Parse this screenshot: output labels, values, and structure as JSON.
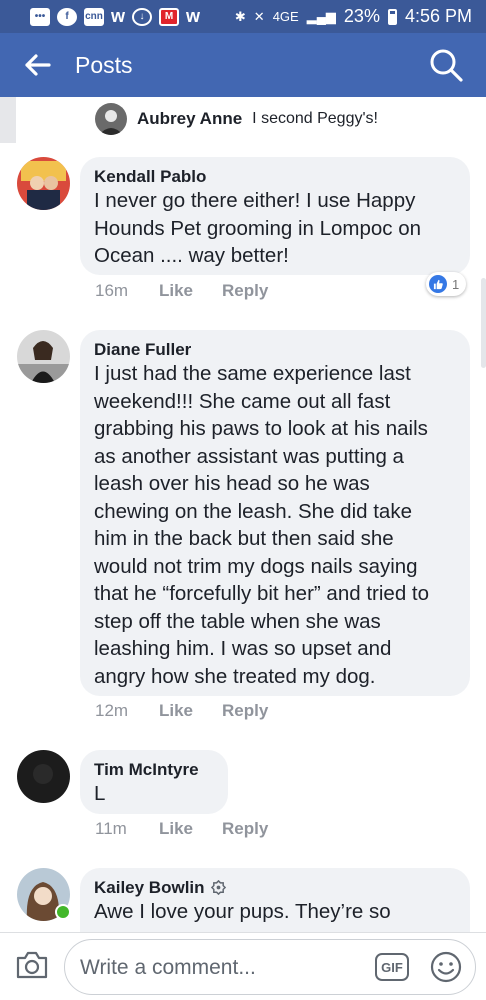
{
  "status_bar": {
    "network": "4GE",
    "battery": "23%",
    "time": "4:56 PM",
    "icons": [
      "messenger-icon",
      "facebook-icon",
      "cnn-icon",
      "w-icon",
      "alert-icon",
      "m-icon",
      "w2-icon",
      "bluetooth-icon",
      "mute-icon",
      "wifi-calling-icon",
      "signal-icon",
      "battery-icon"
    ]
  },
  "header": {
    "title": "Posts"
  },
  "reply_preview": {
    "author": "Aubrey Anne",
    "text": "I second Peggy's!"
  },
  "comments": [
    {
      "author": "Kendall Pablo",
      "lines": [
        "I never go there either! I use Happy",
        "Hounds Pet grooming in Lompoc on",
        "Ocean .... way better!"
      ],
      "time": "16m",
      "like": "Like",
      "reply": "Reply",
      "reactions": "1"
    },
    {
      "author": "Diane Fuller",
      "lines": [
        "I just had the same experience last",
        "weekend!!!  She came out all fast",
        "grabbing his paws to look at his nails",
        "as another assistant was putting a",
        "leash over his head so he was",
        "chewing on the leash. She did take",
        "him in the back but then said she",
        "would not trim my dogs nails saying",
        "that he “forcefully bit her” and tried to",
        "step off the table when she was",
        "leashing him. I was so upset and",
        "angry how she treated my dog."
      ],
      "time": "12m",
      "like": "Like",
      "reply": "Reply"
    },
    {
      "author": "Tim McIntyre",
      "lines": [
        "L"
      ],
      "time": "11m",
      "like": "Like",
      "reply": "Reply"
    },
    {
      "author": "Kailey Bowlin",
      "lines": [
        "Awe I love your pups. They’re so"
      ]
    }
  ],
  "composer": {
    "placeholder": "Write a comment...",
    "gif_label": "GIF"
  },
  "colors": {
    "status_bar": "#3b5998",
    "header": "#4267b2",
    "bubble": "#f0f2f5",
    "online": "#42b72a",
    "like_blue": "#3578e5"
  }
}
